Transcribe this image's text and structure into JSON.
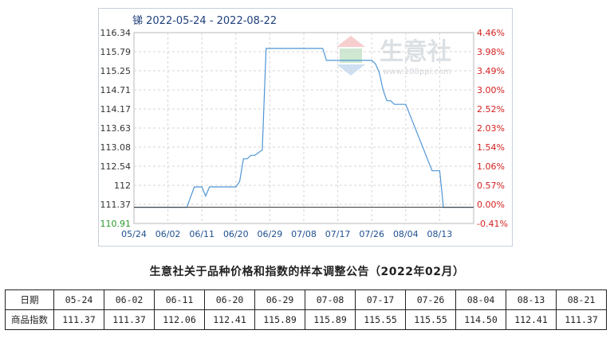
{
  "chart_data": {
    "type": "line",
    "title": "锑 2022-05-24 - 2022-08-22",
    "y_left_ticks": [
      "116.34",
      "115.79",
      "115.25",
      "114.71",
      "114.17",
      "113.63",
      "113.08",
      "112.54",
      "112",
      "111.37",
      "110.91"
    ],
    "y_right_ticks": [
      "4.46%",
      "3.98%",
      "3.49%",
      "3.00%",
      "2.52%",
      "2.03%",
      "1.54%",
      "1.06%",
      "0.57%",
      "0.00%",
      "-0.41%"
    ],
    "x_ticks": [
      "05/24",
      "06/02",
      "06/11",
      "06/20",
      "06/29",
      "07/08",
      "07/17",
      "07/26",
      "08/04",
      "08/13"
    ],
    "ylim": [
      110.91,
      116.34
    ],
    "baseline": 111.37,
    "series": [
      {
        "x": [
          "05-24",
          "06-07",
          "06-09",
          "06-11",
          "06-12",
          "06-13",
          "06-20",
          "06-21",
          "06-22",
          "06-23",
          "06-24",
          "06-25",
          "06-27",
          "06-28",
          "06-30",
          "07-13",
          "07-14",
          "07-26",
          "07-27",
          "07-28",
          "07-29",
          "07-30",
          "07-31",
          "08-01",
          "08-03",
          "08-04",
          "08-11",
          "08-12",
          "08-13",
          "08-14",
          "08-15",
          "08-22"
        ],
        "values": [
          111.37,
          111.37,
          111.95,
          111.95,
          111.69,
          111.95,
          111.95,
          112.1,
          112.75,
          112.75,
          112.85,
          112.85,
          113.0,
          115.89,
          115.89,
          115.89,
          115.55,
          115.55,
          115.45,
          115.2,
          114.71,
          114.4,
          114.4,
          114.3,
          114.3,
          114.3,
          112.41,
          112.41,
          112.41,
          111.37,
          111.37,
          111.37
        ]
      }
    ],
    "colors": {
      "line": "#4f95d6",
      "baseline": "#333333",
      "left_axis": "#333333",
      "right_axis": "#d42020",
      "bottom_left": "#2a9a2a",
      "x_axis": "#1e4f8f"
    }
  },
  "watermark": {
    "name": "生意社",
    "url": "www.100ppi.com"
  },
  "caption": "生意社关于品种价格和指数的样本调整公告（2022年02月）",
  "table": {
    "date_label": "日期",
    "index_label": "商品指数",
    "dates": [
      "05-24",
      "06-02",
      "06-11",
      "06-20",
      "06-29",
      "07-08",
      "07-17",
      "07-26",
      "08-04",
      "08-13",
      "08-21"
    ],
    "values": [
      "111.37",
      "111.37",
      "112.06",
      "112.41",
      "115.89",
      "115.89",
      "115.55",
      "115.55",
      "114.50",
      "112.41",
      "111.37"
    ]
  }
}
